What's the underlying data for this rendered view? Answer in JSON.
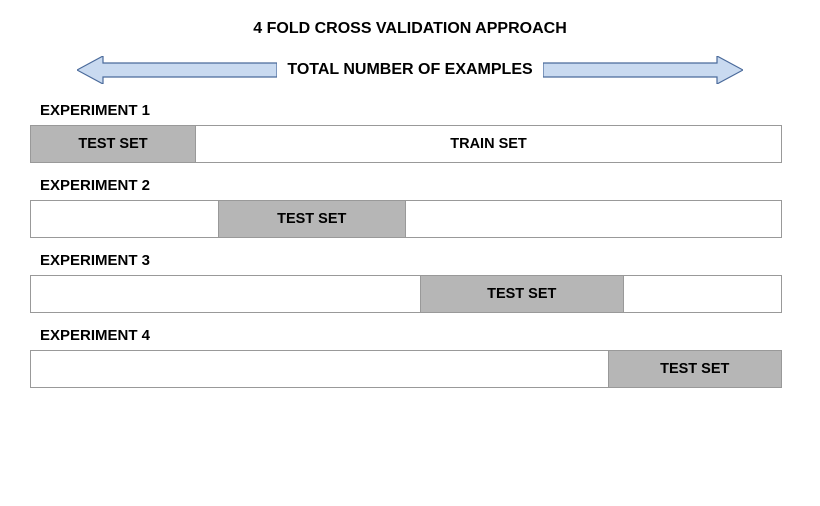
{
  "title": "4 FOLD CROSS VALIDATION APPROACH",
  "subtitle": "TOTAL NUMBER OF EXAMPLES",
  "experiments": [
    {
      "label": "EXPERIMENT 1",
      "segments": [
        {
          "role": "test",
          "label": "TEST SET",
          "widthPct": 22
        },
        {
          "role": "train",
          "label": "TRAIN SET",
          "widthPct": 78
        }
      ]
    },
    {
      "label": "EXPERIMENT 2",
      "segments": [
        {
          "role": "empty",
          "label": "",
          "widthPct": 25
        },
        {
          "role": "test",
          "label": "TEST SET",
          "widthPct": 25
        },
        {
          "role": "empty",
          "label": "",
          "widthPct": 50
        }
      ]
    },
    {
      "label": "EXPERIMENT 3",
      "segments": [
        {
          "role": "empty",
          "label": "",
          "widthPct": 52
        },
        {
          "role": "test",
          "label": "TEST SET",
          "widthPct": 27
        },
        {
          "role": "empty",
          "label": "",
          "widthPct": 21
        }
      ]
    },
    {
      "label": "EXPERIMENT 4",
      "segments": [
        {
          "role": "empty",
          "label": "",
          "widthPct": 77
        },
        {
          "role": "test",
          "label": "TEST SET",
          "widthPct": 23
        }
      ]
    }
  ],
  "colors": {
    "arrowFill": "#c9daf0",
    "arrowStroke": "#4a6a9b",
    "testFill": "#b6b6b6",
    "border": "#999999"
  }
}
